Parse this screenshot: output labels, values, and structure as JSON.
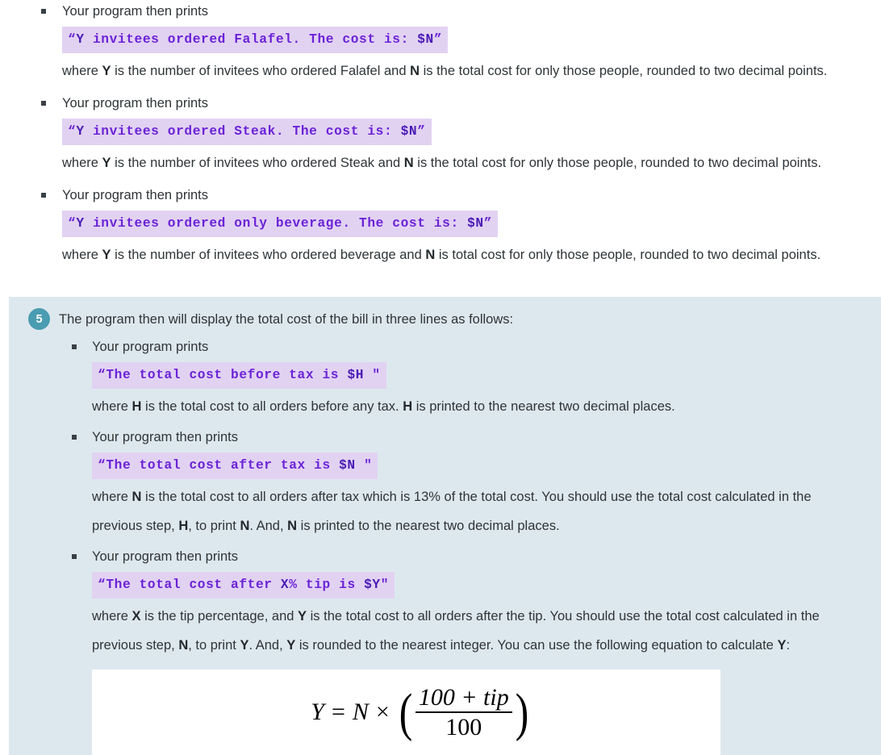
{
  "document": {
    "type": "assignment-instructions",
    "colors": {
      "page_background": "#ffffff",
      "panel_background": "#dde8ee",
      "code_background": "#e2d2f2",
      "code_text": "#6b23d6",
      "badge_background": "#4a9cb0",
      "body_text": "#2f3437"
    }
  },
  "top_section": {
    "bullets": [
      {
        "lead": "Your program then prints",
        "code": "“Y invitees ordered Falafel. The cost is: $N”",
        "where_parts": [
          {
            "t": "where ",
            "b": false
          },
          {
            "t": "Y",
            "b": true
          },
          {
            "t": " is the number of invitees who ordered Falafel and ",
            "b": false
          },
          {
            "t": "N",
            "b": true
          },
          {
            "t": " is the total cost for only those people, rounded to two decimal points.",
            "b": false
          }
        ]
      },
      {
        "lead": "Your program then prints",
        "code": "“Y invitees ordered Steak. The cost is: $N”",
        "where_parts": [
          {
            "t": "where ",
            "b": false
          },
          {
            "t": "Y",
            "b": true
          },
          {
            "t": " is the number of invitees who ordered Steak and ",
            "b": false
          },
          {
            "t": "N",
            "b": true
          },
          {
            "t": " is the total cost for only those people, rounded to two decimal points.",
            "b": false
          }
        ]
      },
      {
        "lead": "Your program then prints",
        "code": "“Y invitees ordered only beverage. The cost is: $N”",
        "where_parts": [
          {
            "t": "where ",
            "b": false
          },
          {
            "t": "Y",
            "b": true
          },
          {
            "t": " is the number of invitees who ordered beverage and ",
            "b": false
          },
          {
            "t": "N",
            "b": true
          },
          {
            "t": " is total cost for only those people, rounded to two decimal points.",
            "b": false
          }
        ]
      }
    ]
  },
  "step_five": {
    "number": "5",
    "heading": "The program then will display the total cost of the bill in three lines as follows:",
    "bullets": [
      {
        "lead": "Your program prints",
        "code": "“The total cost before tax is $H \"",
        "where_parts": [
          {
            "t": "where ",
            "b": false
          },
          {
            "t": "H",
            "b": true
          },
          {
            "t": " is the total cost to all orders before any tax. ",
            "b": false
          },
          {
            "t": "H",
            "b": true
          },
          {
            "t": " is printed to the nearest two decimal places.",
            "b": false
          }
        ]
      },
      {
        "lead": "Your program then prints",
        "code": "“The total cost after tax is $N \"",
        "where_parts": [
          {
            "t": "where ",
            "b": false
          },
          {
            "t": "N",
            "b": true
          },
          {
            "t": " is the total cost to all orders after tax which is 13% of the total cost. You should use the total cost calculated in the previous step, ",
            "b": false
          },
          {
            "t": "H",
            "b": true
          },
          {
            "t": ", to print ",
            "b": false
          },
          {
            "t": "N",
            "b": true
          },
          {
            "t": ". And, ",
            "b": false
          },
          {
            "t": "N",
            "b": true
          },
          {
            "t": " is printed to the nearest two decimal places.",
            "b": false
          }
        ]
      },
      {
        "lead": "Your program then prints",
        "code": "“The total cost after X% tip is $Y\"",
        "where_parts": [
          {
            "t": "where ",
            "b": false
          },
          {
            "t": "X",
            "b": true
          },
          {
            "t": " is the tip percentage, and ",
            "b": false
          },
          {
            "t": "Y",
            "b": true
          },
          {
            "t": " is the total cost to all orders after the tip. You should use the total cost calculated in the previous step, ",
            "b": false
          },
          {
            "t": "N",
            "b": true
          },
          {
            "t": ", to print ",
            "b": false
          },
          {
            "t": "Y",
            "b": true
          },
          {
            "t": ". And, ",
            "b": false
          },
          {
            "t": "Y",
            "b": true
          },
          {
            "t": " is rounded to the nearest integer. You can use the following equation to calculate ",
            "b": false
          },
          {
            "t": "Y",
            "b": true
          },
          {
            "t": ":",
            "b": false
          }
        ]
      }
    ],
    "formula": {
      "lhs": "Y",
      "equals": "=",
      "rhs_var": "N",
      "times": "×",
      "numerator": "100 + tip",
      "denominator": "100",
      "plain_text": "Y = N × ( (100 + tip) / 100 )"
    }
  }
}
